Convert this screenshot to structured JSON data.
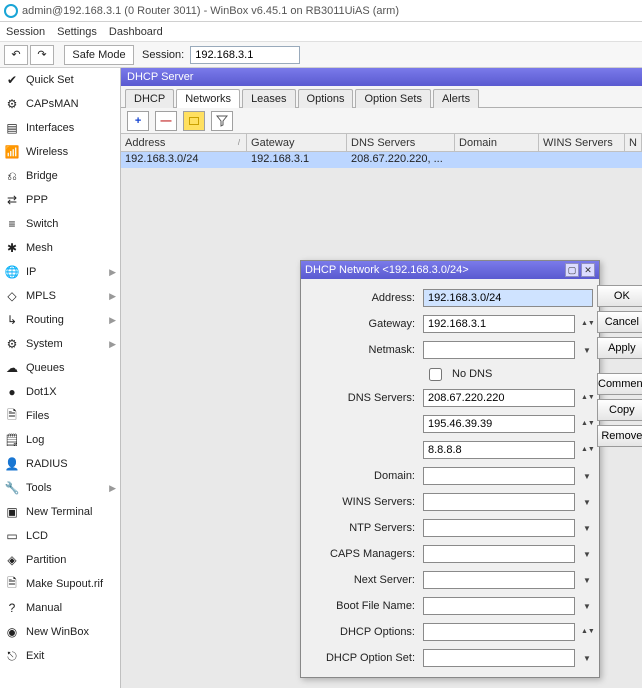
{
  "window": {
    "title": "admin@192.168.3.1 (0 Router 3011) - WinBox v6.45.1 on RB3011UiAS (arm)"
  },
  "menu": {
    "items": [
      "Session",
      "Settings",
      "Dashboard"
    ]
  },
  "toolbar": {
    "safe_mode": "Safe Mode",
    "session_label": "Session:",
    "session_ip": "192.168.3.1"
  },
  "sidebar": {
    "items": [
      {
        "label": "Quick Set",
        "icon": "✔",
        "chev": false
      },
      {
        "label": "CAPsMAN",
        "icon": "⚙",
        "chev": false
      },
      {
        "label": "Interfaces",
        "icon": "▤",
        "chev": false
      },
      {
        "label": "Wireless",
        "icon": "📶",
        "chev": false
      },
      {
        "label": "Bridge",
        "icon": "⎌",
        "chev": false
      },
      {
        "label": "PPP",
        "icon": "⇄",
        "chev": false
      },
      {
        "label": "Switch",
        "icon": "≡",
        "chev": false
      },
      {
        "label": "Mesh",
        "icon": "✱",
        "chev": false
      },
      {
        "label": "IP",
        "icon": "🌐",
        "chev": true
      },
      {
        "label": "MPLS",
        "icon": "◇",
        "chev": true
      },
      {
        "label": "Routing",
        "icon": "↳",
        "chev": true
      },
      {
        "label": "System",
        "icon": "⚙",
        "chev": true
      },
      {
        "label": "Queues",
        "icon": "☁",
        "chev": false
      },
      {
        "label": "Dot1X",
        "icon": "●",
        "chev": false
      },
      {
        "label": "Files",
        "icon": "🗎",
        "chev": false
      },
      {
        "label": "Log",
        "icon": "🗒",
        "chev": false
      },
      {
        "label": "RADIUS",
        "icon": "👤",
        "chev": false
      },
      {
        "label": "Tools",
        "icon": "🔧",
        "chev": true
      },
      {
        "label": "New Terminal",
        "icon": "▣",
        "chev": false
      },
      {
        "label": "LCD",
        "icon": "▭",
        "chev": false
      },
      {
        "label": "Partition",
        "icon": "◈",
        "chev": false
      },
      {
        "label": "Make Supout.rif",
        "icon": "🗎",
        "chev": false
      },
      {
        "label": "Manual",
        "icon": "?",
        "chev": false
      },
      {
        "label": "New WinBox",
        "icon": "◉",
        "chev": false
      },
      {
        "label": "Exit",
        "icon": "⎋",
        "chev": false
      }
    ]
  },
  "panel": {
    "title": "DHCP Server",
    "tabs": [
      "DHCP",
      "Networks",
      "Leases",
      "Options",
      "Option Sets",
      "Alerts"
    ],
    "active_tab": 1,
    "columns": [
      "Address",
      "Gateway",
      "DNS Servers",
      "Domain",
      "WINS Servers",
      "N"
    ],
    "row": {
      "address": "192.168.3.0/24",
      "gateway": "192.168.3.1",
      "dns": "208.67.220.220, ...",
      "domain": "",
      "wins": ""
    }
  },
  "dialog": {
    "title": "DHCP Network <192.168.3.0/24>",
    "buttons": {
      "ok": "OK",
      "cancel": "Cancel",
      "apply": "Apply",
      "comment": "Comment",
      "copy": "Copy",
      "remove": "Remove"
    },
    "labels": {
      "address": "Address:",
      "gateway": "Gateway:",
      "netmask": "Netmask:",
      "nodns": "No DNS",
      "dns": "DNS Servers:",
      "domain": "Domain:",
      "wins": "WINS Servers:",
      "ntp": "NTP Servers:",
      "caps": "CAPS Managers:",
      "next": "Next Server:",
      "boot": "Boot File Name:",
      "dhcpopt": "DHCP Options:",
      "dhcpset": "DHCP Option Set:"
    },
    "values": {
      "address": "192.168.3.0/24",
      "gateway": "192.168.3.1",
      "netmask": "",
      "dns1": "208.67.220.220",
      "dns2": "195.46.39.39",
      "dns3": "8.8.8.8",
      "domain": "",
      "wins": "",
      "ntp": "",
      "caps": "",
      "next": "",
      "boot": "",
      "dhcpopt": "",
      "dhcpset": ""
    }
  }
}
